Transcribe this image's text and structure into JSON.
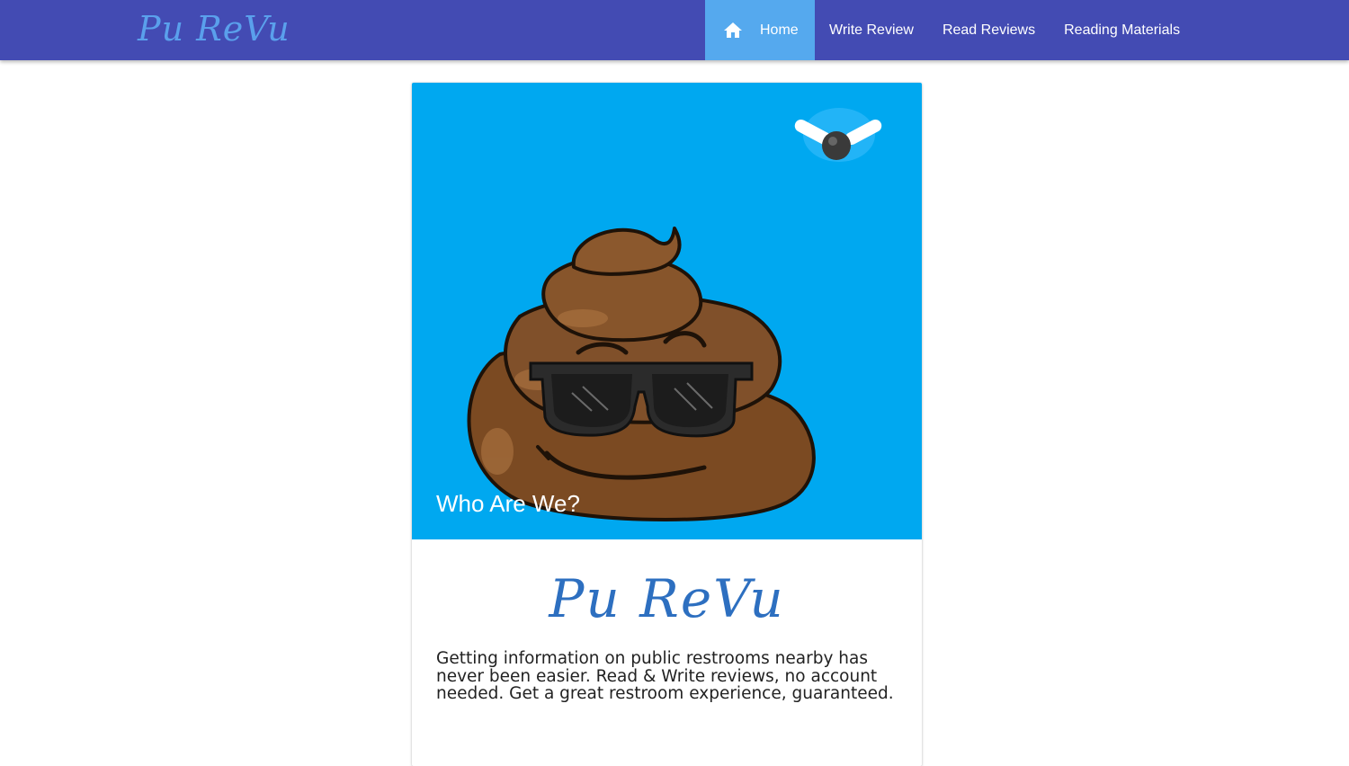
{
  "navbar": {
    "brand": "Pu ReVu",
    "items": [
      {
        "label": "Home",
        "icon": "home-icon",
        "active": true
      },
      {
        "label": "Write Review",
        "active": false
      },
      {
        "label": "Read Reviews",
        "active": false
      },
      {
        "label": "Reading Materials",
        "active": false
      }
    ]
  },
  "card": {
    "image_title": "Who Are We?",
    "image_icons": [
      "poop-mascot-with-sunglasses",
      "fly-icon"
    ],
    "logo": "Pu ReVu",
    "description": "Getting information on public restrooms nearby has never been easier. Read & Write reviews, no account needed. Get a great restroom experience, guaranteed."
  },
  "colors": {
    "navbar": "#434bb3",
    "active_nav": "#55a9ee",
    "brand": "#5aa0ec",
    "card_image_bg": "#00a8f0",
    "logo": "#2d6fc0"
  }
}
